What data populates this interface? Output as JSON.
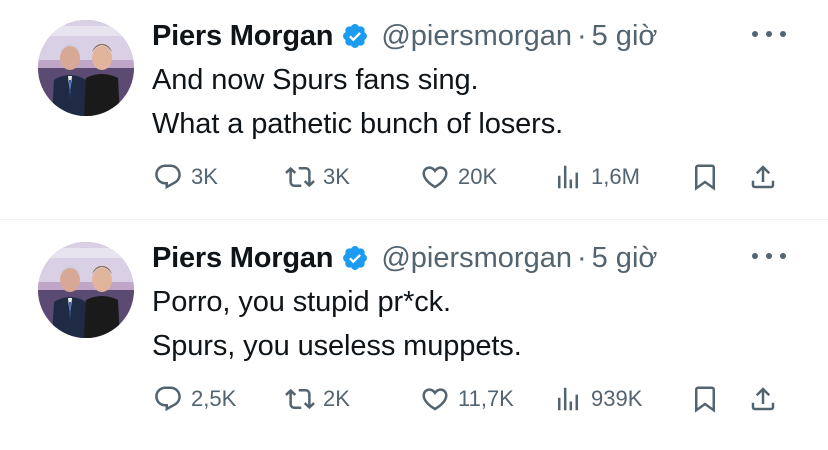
{
  "tweets": [
    {
      "author": {
        "name": "Piers Morgan",
        "handle": "@piersmorgan",
        "verified": true
      },
      "separator": "·",
      "time": "5 giờ",
      "lines": [
        "And now Spurs fans sing.",
        "What a pathetic bunch of losers."
      ],
      "stats": {
        "replies": "3K",
        "retweets": "3K",
        "likes": "20K",
        "views": "1,6M"
      }
    },
    {
      "author": {
        "name": "Piers Morgan",
        "handle": "@piersmorgan",
        "verified": true
      },
      "separator": "·",
      "time": "5 giờ",
      "lines": [
        "Porro, you stupid pr*ck.",
        "Spurs, you useless muppets."
      ],
      "stats": {
        "replies": "2,5K",
        "retweets": "2K",
        "likes": "11,7K",
        "views": "939K"
      }
    }
  ],
  "colors": {
    "text": "#0f1419",
    "secondary": "#536471",
    "verified": "#1d9bf0",
    "divider": "#eff3f4"
  },
  "icons": [
    "reply-icon",
    "retweet-icon",
    "like-icon",
    "views-icon",
    "bookmark-icon",
    "share-icon",
    "more-icon",
    "verified-badge-icon"
  ]
}
